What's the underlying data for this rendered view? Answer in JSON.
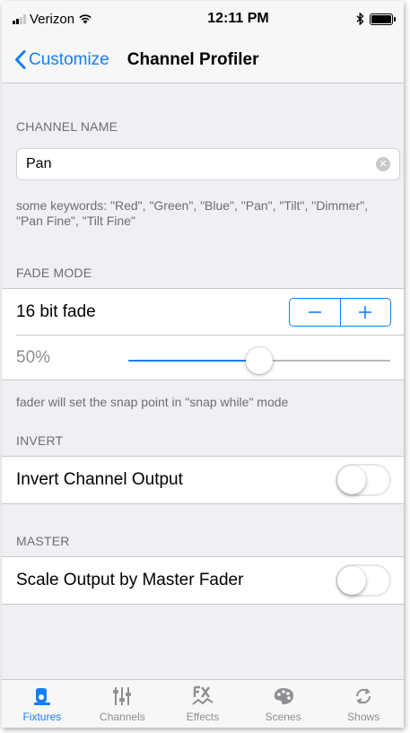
{
  "status_bar": {
    "carrier": "Verizon",
    "time": "12:11 PM",
    "bluetooth_icon": "bluetooth-icon",
    "battery_level": 1.0
  },
  "nav": {
    "back_label": "Customize",
    "title": "Channel Profiler"
  },
  "channel_name": {
    "header": "CHANNEL NAME",
    "value": "Pan",
    "hint": "some keywords: \"Red\", \"Green\", \"Blue\", \"Pan\", \"Tilt\", \"Dimmer\", \"Pan Fine\", \"Tilt Fine\""
  },
  "fade_mode": {
    "header": "FADE MODE",
    "mode_label": "16 bit fade",
    "stepper_minus": "−",
    "stepper_plus": "+",
    "slider_label": "50%",
    "slider_value": 0.5,
    "footer": "fader will set the snap point in \"snap while\" mode"
  },
  "invert": {
    "header": "INVERT",
    "label": "Invert Channel Output",
    "on": false
  },
  "master": {
    "header": "MASTER",
    "label": "Scale Output by Master Fader",
    "on": false
  },
  "tabs": [
    {
      "label": "Fixtures",
      "icon": "fixture-icon",
      "active": true
    },
    {
      "label": "Channels",
      "icon": "sliders-icon",
      "active": false
    },
    {
      "label": "Effects",
      "icon": "fx-icon",
      "active": false
    },
    {
      "label": "Scenes",
      "icon": "palette-icon",
      "active": false
    },
    {
      "label": "Shows",
      "icon": "refresh-icon",
      "active": false
    }
  ],
  "colors": {
    "accent": "#147efb",
    "background": "#efeff4",
    "secondary_text": "#6d6d72"
  }
}
